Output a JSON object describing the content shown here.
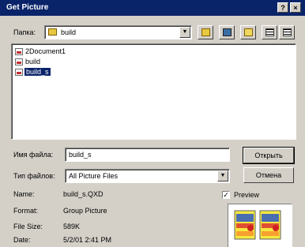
{
  "window": {
    "title": "Get Picture",
    "help_button": "?",
    "close_button": "×"
  },
  "lookin": {
    "label": "Папка:",
    "value": "build"
  },
  "files": [
    {
      "name": "2Document1",
      "selected": false
    },
    {
      "name": "build",
      "selected": false
    },
    {
      "name": "build_s",
      "selected": true
    }
  ],
  "filename": {
    "label": "Имя файла:",
    "value": "build_s"
  },
  "filetype": {
    "label": "Тип файлов:",
    "value": "All Picture Files"
  },
  "buttons": {
    "open": "Открыть",
    "cancel": "Отмена"
  },
  "info": {
    "name_label": "Name:",
    "name_value": "build_s.QXD",
    "format_label": "Format:",
    "format_value": "Group Picture",
    "size_label": "File Size:",
    "size_value": "589K",
    "date_label": "Date:",
    "date_value": "5/2/01 2:41 PM"
  },
  "preview": {
    "label": "Preview",
    "checked": true
  },
  "icons": [
    "folder-icon",
    "up-folder-icon",
    "desktop-icon",
    "new-folder-icon",
    "list-view-icon",
    "details-view-icon",
    "file-icon",
    "chevron-down-icon",
    "preview-thumbnail-icon"
  ]
}
